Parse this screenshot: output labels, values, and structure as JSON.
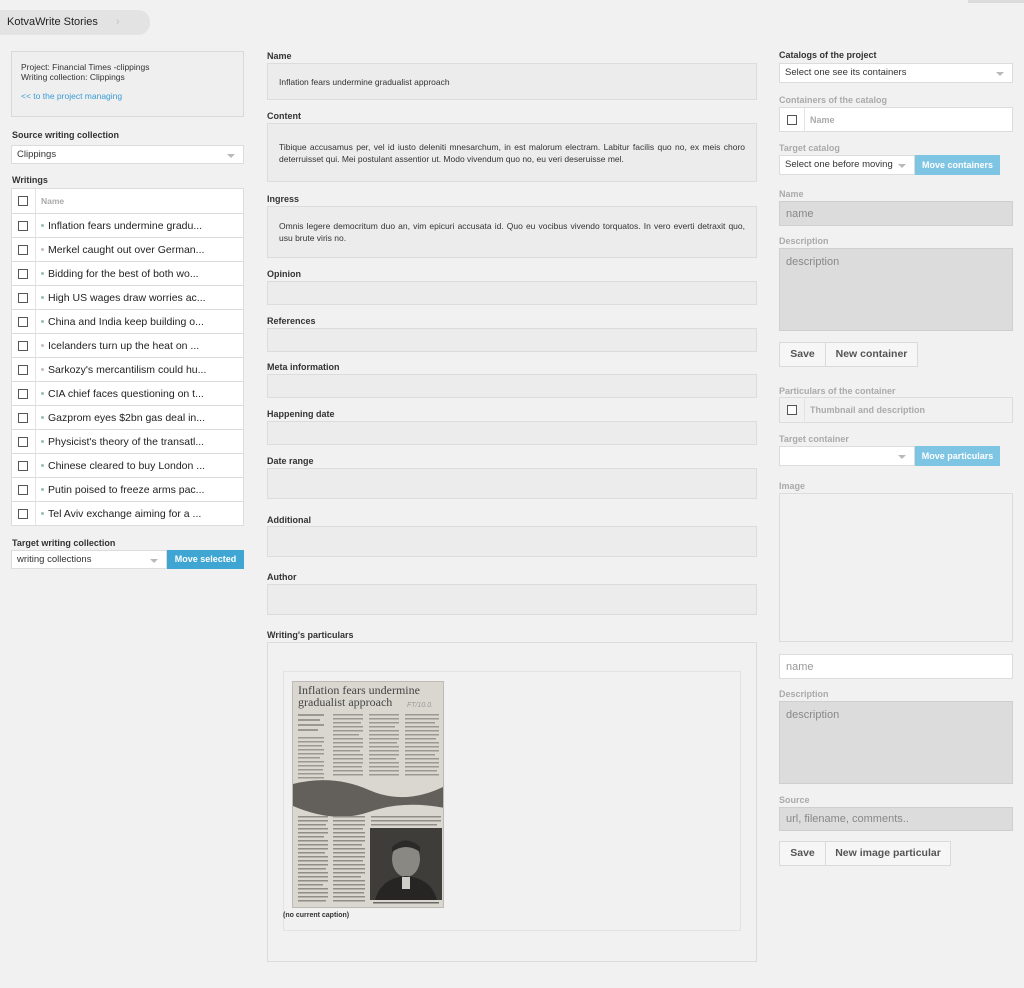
{
  "breadcrumb": {
    "app": "KotvaWrite Stories",
    "chevron": "›"
  },
  "project_info": {
    "project": "Project: Financial Times -clippings",
    "collection": "Writing collection: Clippings",
    "manage_link": "<< to the project managing"
  },
  "source": {
    "label": "Source writing collection",
    "value": "Clippings"
  },
  "writings": {
    "label": "Writings",
    "header": "Name",
    "items": [
      "Inflation fears undermine gradu...",
      "Merkel caught out over German...",
      "Bidding for the best of both wo...",
      "High US wages draw worries ac...",
      "China and India keep building o...",
      "Icelanders turn up the heat on ...",
      "Sarkozy's mercantilism could hu...",
      "CIA chief faces questioning on t...",
      "Gazprom eyes $2bn gas deal in...",
      "Physicist's theory of the transatl...",
      "Chinese cleared to buy London ...",
      "Putin poised to freeze arms pac...",
      "Tel Aviv exchange aiming for a ..."
    ]
  },
  "target": {
    "label": "Target writing collection",
    "value": "writing collections",
    "button": "Move selected"
  },
  "middle": {
    "name_label": "Name",
    "name_value": "Inflation fears undermine gradualist approach",
    "content_label": "Content",
    "content_value": "Tibique accusamus per, vel id iusto deleniti mnesarchum, in est malorum electram. Labitur facilis quo no, ex meis choro deterruisset qui. Mei postulant assentior ut. Modo vivendum quo no, eu veri deseruisse mel.",
    "ingress_label": "Ingress",
    "ingress_value": "Omnis legere democritum duo an, vim epicuri accusata id. Quo eu vocibus vivendo torquatos. In vero everti detraxit quo, usu brute viris no.",
    "opinion_label": "Opinion",
    "references_label": "References",
    "meta_label": "Meta information",
    "happening_label": "Happening date",
    "daterange_label": "Date range",
    "additional_label": "Additional",
    "author_label": "Author",
    "particulars_label": "Writing's particulars",
    "clip_headline": "Inflation fears undermine gradualist approach",
    "clip_handwriting": "FT/10.0.",
    "caption": "(no current caption)"
  },
  "right": {
    "catalogs_label": "Catalogs of the project",
    "catalogs_value": "Select one see its containers",
    "containers_label": "Containers of the catalog",
    "containers_header": "Name",
    "target_catalog_label": "Target catalog",
    "target_catalog_value": "Select one before moving",
    "move_containers": "Move containers",
    "name_label": "Name",
    "name_placeholder": "name",
    "description_label": "Description",
    "description_placeholder": "description",
    "save": "Save",
    "new_container": "New container",
    "particulars_label": "Particulars of the container",
    "particulars_header": "Thumbnail and description",
    "target_container_label": "Target container",
    "move_particulars": "Move particulars",
    "image_label": "Image",
    "img_name_placeholder": "name",
    "img_description_label": "Description",
    "img_description_placeholder": "description",
    "source_label": "Source",
    "source_placeholder": "url, filename, comments..",
    "save2": "Save",
    "new_image_particular": "New image particular"
  },
  "colors": {
    "accent": "#3fa6d3",
    "accent_light": "#7ec4e3",
    "background": "#f1f1f1"
  }
}
